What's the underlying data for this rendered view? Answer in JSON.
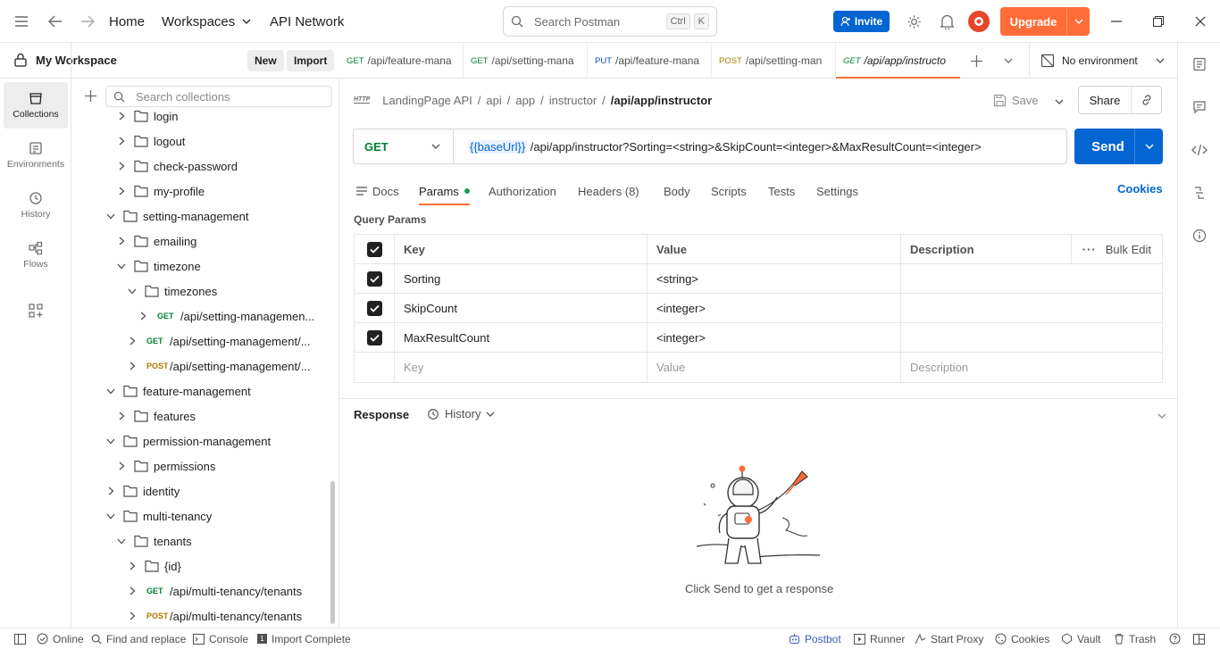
{
  "topbar": {
    "home": "Home",
    "workspaces": "Workspaces",
    "api_network": "API Network",
    "search_placeholder": "Search Postman",
    "shortcut_ctrl": "Ctrl",
    "shortcut_k": "K",
    "invite": "Invite",
    "upgrade": "Upgrade"
  },
  "workspace": {
    "name": "My Workspace",
    "new_label": "New",
    "import_label": "Import",
    "search_placeholder": "Search collections"
  },
  "rail": [
    {
      "label": "Collections",
      "icon": "collections-icon"
    },
    {
      "label": "Environments",
      "icon": "environments-icon"
    },
    {
      "label": "History",
      "icon": "history-icon"
    },
    {
      "label": "Flows",
      "icon": "flows-icon"
    }
  ],
  "tree": [
    {
      "label": "login",
      "kind": "folder",
      "depth": 1,
      "chev": "right"
    },
    {
      "label": "logout",
      "kind": "folder",
      "depth": 1,
      "chev": "right"
    },
    {
      "label": "check-password",
      "kind": "folder",
      "depth": 1,
      "chev": "right"
    },
    {
      "label": "my-profile",
      "kind": "folder",
      "depth": 1,
      "chev": "right"
    },
    {
      "label": "setting-management",
      "kind": "folder",
      "depth": 0,
      "chev": "down"
    },
    {
      "label": "emailing",
      "kind": "folder",
      "depth": 1,
      "chev": "right"
    },
    {
      "label": "timezone",
      "kind": "folder",
      "depth": 1,
      "chev": "down"
    },
    {
      "label": "timezones",
      "kind": "folder",
      "depth": 2,
      "chev": "down"
    },
    {
      "label": "/api/setting-managemen...",
      "kind": "req",
      "method": "GET",
      "depth": 3,
      "chev": "right"
    },
    {
      "label": "/api/setting-management/...",
      "kind": "req",
      "method": "GET",
      "depth": 2,
      "chev": "right"
    },
    {
      "label": "/api/setting-management/...",
      "kind": "req",
      "method": "POST",
      "depth": 2,
      "chev": "right"
    },
    {
      "label": "feature-management",
      "kind": "folder",
      "depth": 0,
      "chev": "down"
    },
    {
      "label": "features",
      "kind": "folder",
      "depth": 1,
      "chev": "right"
    },
    {
      "label": "permission-management",
      "kind": "folder",
      "depth": 0,
      "chev": "down"
    },
    {
      "label": "permissions",
      "kind": "folder",
      "depth": 1,
      "chev": "right"
    },
    {
      "label": "identity",
      "kind": "folder",
      "depth": 0,
      "chev": "right"
    },
    {
      "label": "multi-tenancy",
      "kind": "folder",
      "depth": 0,
      "chev": "down"
    },
    {
      "label": "tenants",
      "kind": "folder",
      "depth": 1,
      "chev": "down"
    },
    {
      "label": "{id}",
      "kind": "folder",
      "depth": 2,
      "chev": "right"
    },
    {
      "label": "/api/multi-tenancy/tenants",
      "kind": "req",
      "method": "GET",
      "depth": 2,
      "chev": "right"
    },
    {
      "label": "/api/multi-tenancy/tenants",
      "kind": "req",
      "method": "POST",
      "depth": 2,
      "chev": "right"
    }
  ],
  "tabs": [
    {
      "method": "GET",
      "label": "/api/feature-mana"
    },
    {
      "method": "GET",
      "label": "/api/setting-mana"
    },
    {
      "method": "PUT",
      "label": "/api/feature-mana"
    },
    {
      "method": "POST",
      "label": "/api/setting-man"
    },
    {
      "method": "GET",
      "label": "/api/app/instructo",
      "active": true
    }
  ],
  "environment": "No environment",
  "breadcrumb": {
    "items": [
      "LandingPage API",
      "api",
      "app",
      "instructor"
    ],
    "sep": "/",
    "current": "/api/app/instructor",
    "http": "HTTP"
  },
  "actions": {
    "save": "Save",
    "share": "Share"
  },
  "request": {
    "method": "GET",
    "url_var": "{{baseUrl}}",
    "url_rest": " /api/app/instructor?Sorting=<string>&SkipCount=<integer>&MaxResultCount=<integer>",
    "send": "Send"
  },
  "req_tabs": {
    "docs": "Docs",
    "params": "Params",
    "authorization": "Authorization",
    "headers": "Headers (8)",
    "body": "Body",
    "scripts": "Scripts",
    "tests": "Tests",
    "settings": "Settings",
    "cookies": "Cookies"
  },
  "params": {
    "section_title": "Query Params",
    "headers": {
      "key": "Key",
      "value": "Value",
      "description": "Description",
      "bulk": "Bulk Edit"
    },
    "rows": [
      {
        "key": "Sorting",
        "value": "<string>",
        "description": ""
      },
      {
        "key": "SkipCount",
        "value": "<integer>",
        "description": ""
      },
      {
        "key": "MaxResultCount",
        "value": "<integer>",
        "description": ""
      }
    ],
    "placeholder": {
      "key": "Key",
      "value": "Value",
      "description": "Description"
    }
  },
  "response": {
    "title": "Response",
    "history": "History",
    "empty_text": "Click Send to get a response"
  },
  "footer": {
    "online": "Online",
    "find_replace": "Find and replace",
    "console": "Console",
    "import_complete": "Import Complete",
    "postbot": "Postbot",
    "runner": "Runner",
    "start_proxy": "Start Proxy",
    "cookies": "Cookies",
    "vault": "Vault",
    "trash": "Trash"
  },
  "colors": {
    "accent": "#ff6c37",
    "primary": "#0265d2",
    "get": "#007f31",
    "post": "#ad7a03",
    "put": "#0053b8"
  }
}
